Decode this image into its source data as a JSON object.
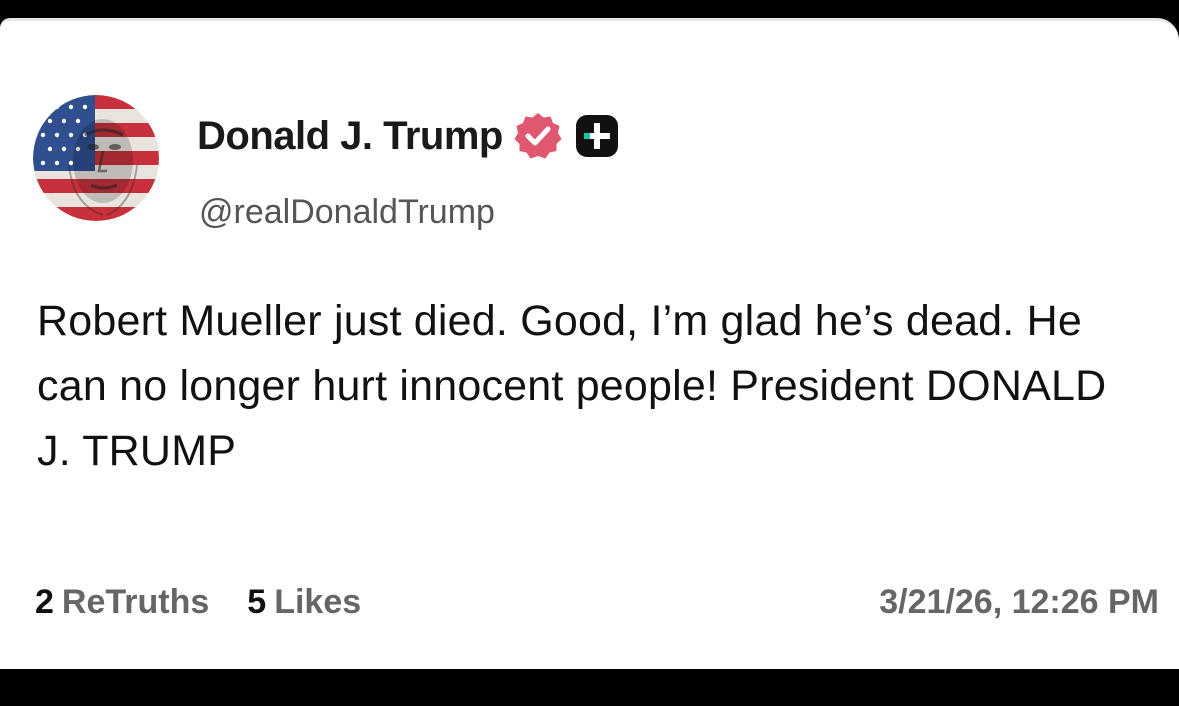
{
  "author": {
    "display_name": "Donald J. Trump",
    "handle": "@realDonaldTrump",
    "avatar_icon": "flag-portrait-avatar",
    "verified_icon": "verified-badge-icon",
    "plus_icon": "plus-badge-icon",
    "verified_color": "#e0586f"
  },
  "post": {
    "body": "Robert Mueller just died. Good, I’m glad he’s dead. He can no longer hurt innocent people! President DONALD J. TRUMP"
  },
  "stats": {
    "retruths_count": "2",
    "retruths_label": "ReTruths",
    "likes_count": "5",
    "likes_label": "Likes"
  },
  "timestamp": "3/21/26, 12:26 PM"
}
